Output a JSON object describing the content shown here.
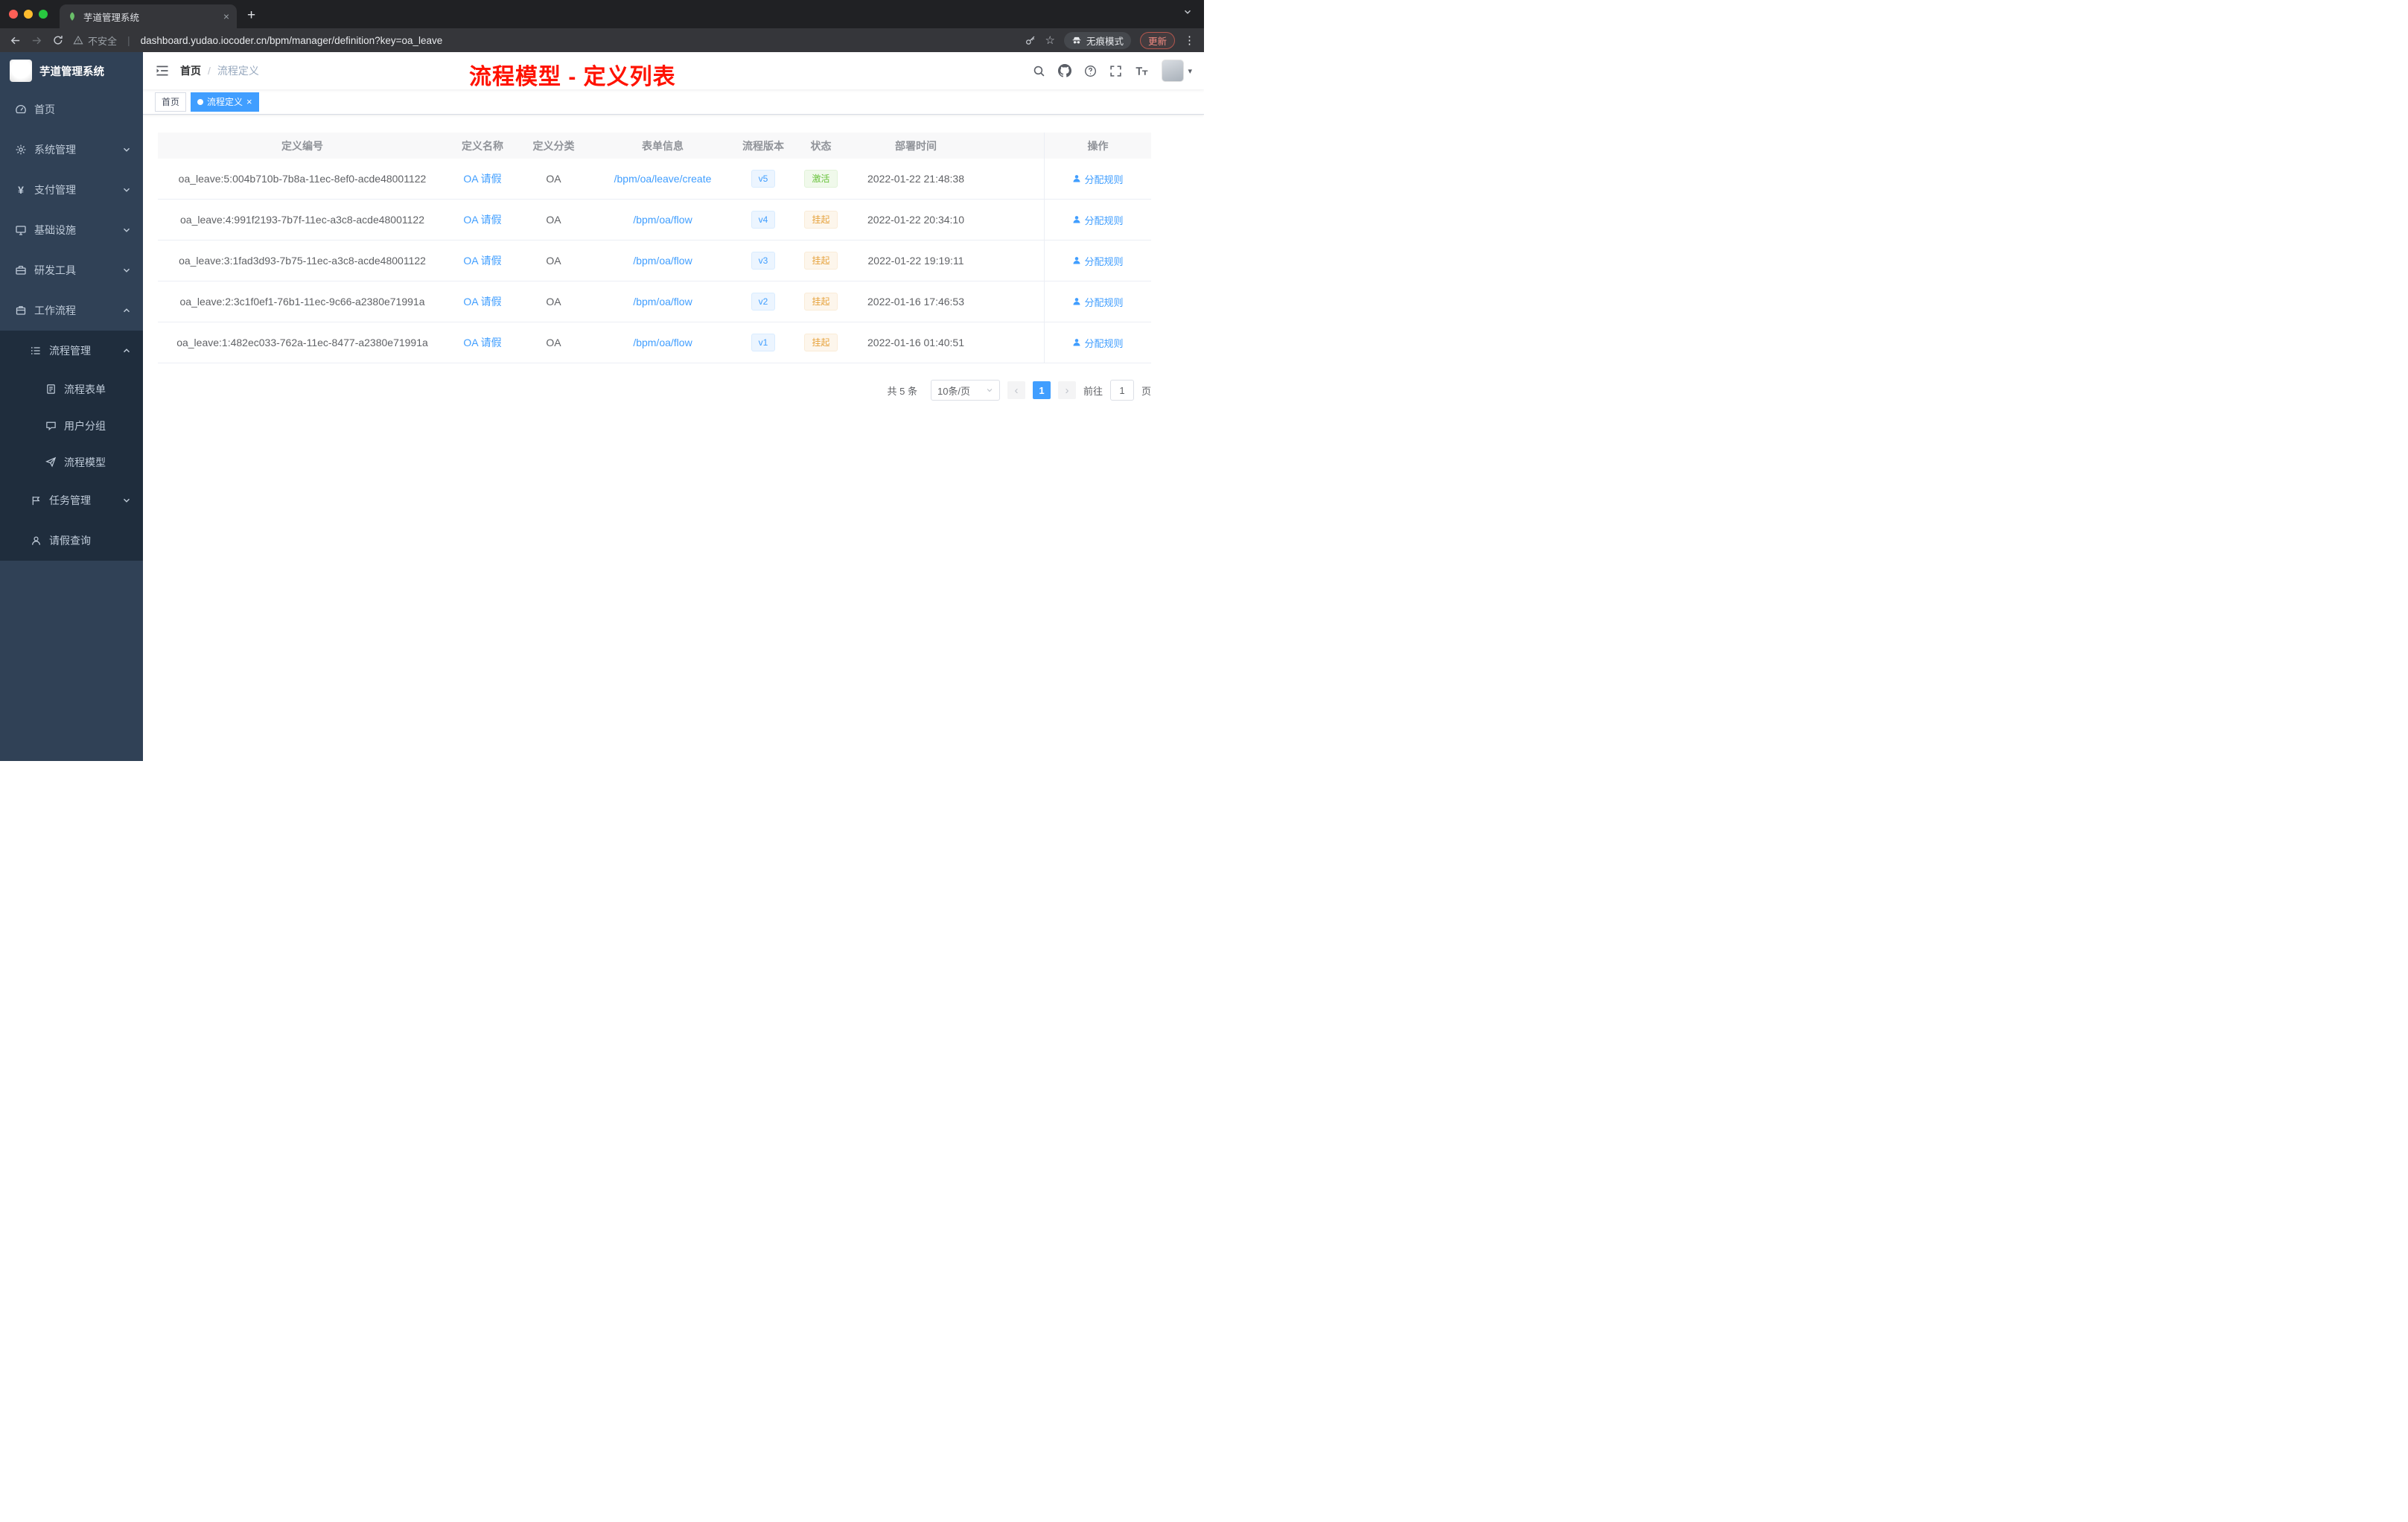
{
  "browser": {
    "tab_title": "芋道管理系统",
    "security_label": "不安全",
    "url": "dashboard.yudao.iocoder.cn/bpm/manager/definition?key=oa_leave",
    "incognito_label": "无痕模式",
    "update_label": "更新"
  },
  "sidebar": {
    "logo_title": "芋道管理系统",
    "items": {
      "home": "首页",
      "system": "系统管理",
      "pay": "支付管理",
      "infra": "基础设施",
      "dev": "研发工具",
      "workflow": "工作流程",
      "process_mgmt": "流程管理",
      "process_form": "流程表单",
      "user_group": "用户分组",
      "process_model": "流程模型",
      "task_mgmt": "任务管理",
      "leave_query": "请假查询"
    }
  },
  "header": {
    "breadcrumb_home": "首页",
    "breadcrumb_sep": "/",
    "breadcrumb_current": "流程定义",
    "annotation": "流程模型 - 定义列表"
  },
  "tags": {
    "home": "首页",
    "current": "流程定义"
  },
  "table": {
    "columns": {
      "id": "定义编号",
      "name": "定义名称",
      "category": "定义分类",
      "form": "表单信息",
      "version": "流程版本",
      "status": "状态",
      "deploy_time": "部署时间",
      "action": "操作"
    },
    "rows": [
      {
        "id": "oa_leave:5:004b710b-7b8a-11ec-8ef0-acde48001122",
        "name": "OA 请假",
        "category": "OA",
        "form": "/bpm/oa/leave/create",
        "version": "v5",
        "status": "激活",
        "status_type": "success",
        "deploy_time": "2022-01-22 21:48:38",
        "action": "分配规则"
      },
      {
        "id": "oa_leave:4:991f2193-7b7f-11ec-a3c8-acde48001122",
        "name": "OA 请假",
        "category": "OA",
        "form": "/bpm/oa/flow",
        "version": "v4",
        "status": "挂起",
        "status_type": "warning",
        "deploy_time": "2022-01-22 20:34:10",
        "action": "分配规则"
      },
      {
        "id": "oa_leave:3:1fad3d93-7b75-11ec-a3c8-acde48001122",
        "name": "OA 请假",
        "category": "OA",
        "form": "/bpm/oa/flow",
        "version": "v3",
        "status": "挂起",
        "status_type": "warning",
        "deploy_time": "2022-01-22 19:19:11",
        "action": "分配规则"
      },
      {
        "id": "oa_leave:2:3c1f0ef1-76b1-11ec-9c66-a2380e71991a",
        "name": "OA 请假",
        "category": "OA",
        "form": "/bpm/oa/flow",
        "version": "v2",
        "status": "挂起",
        "status_type": "warning",
        "deploy_time": "2022-01-16 17:46:53",
        "action": "分配规则"
      },
      {
        "id": "oa_leave:1:482ec033-762a-11ec-8477-a2380e71991a",
        "name": "OA 请假",
        "category": "OA",
        "form": "/bpm/oa/flow",
        "version": "v1",
        "status": "挂起",
        "status_type": "warning",
        "deploy_time": "2022-01-16 01:40:51",
        "action": "分配规则"
      }
    ]
  },
  "pagination": {
    "total_label": "共 5 条",
    "page_size_label": "10条/页",
    "current_page": "1",
    "goto_label": "前往",
    "goto_value": "1",
    "page_unit_label": "页"
  },
  "colors": {
    "accent": "#409eff",
    "success": "#67c23a",
    "warning": "#e6a23c",
    "annotation_red": "#ff1200",
    "sidebar_bg": "#304156",
    "sidebar_submenu_bg": "#1f2d3d"
  },
  "icons": {
    "favicon": "leaf",
    "security": "warning-triangle",
    "toolbar_right": [
      "key",
      "star",
      "incognito-spy",
      "update",
      "vertical-dots"
    ],
    "navbar_right": [
      "search",
      "github",
      "help",
      "fullscreen",
      "font-size",
      "avatar"
    ]
  }
}
